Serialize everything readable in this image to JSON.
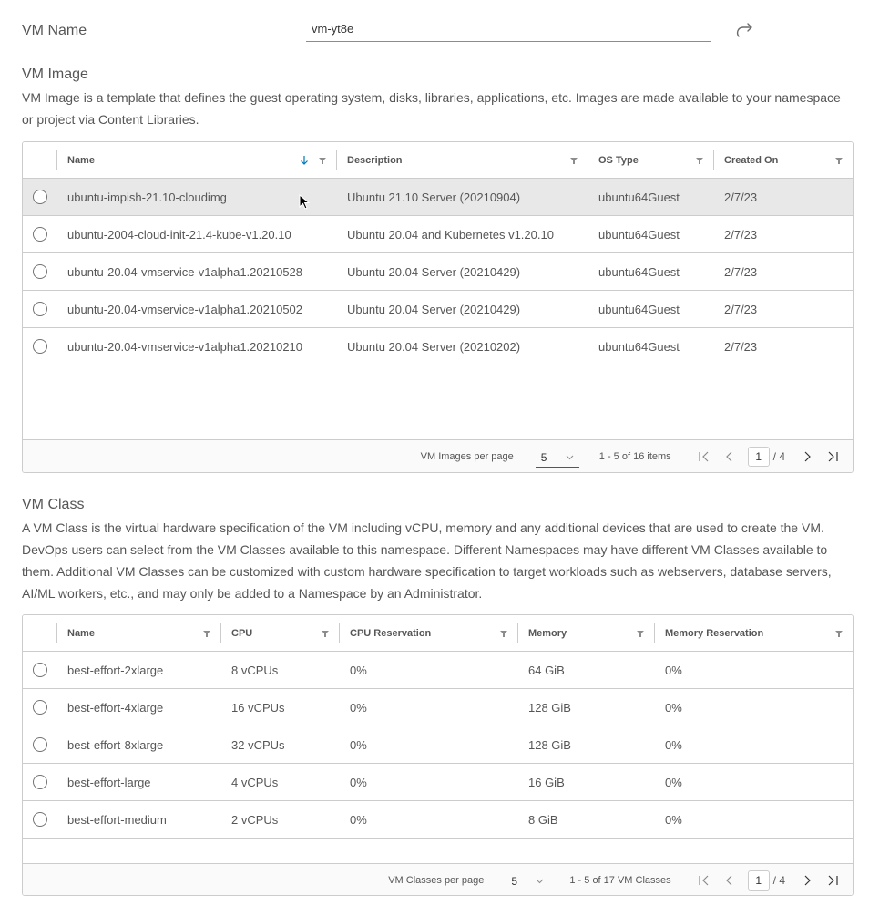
{
  "vm_name": {
    "label": "VM Name",
    "value": "vm-yt8e",
    "regenerate_icon": "redo-arrow-icon"
  },
  "vm_image": {
    "title": "VM Image",
    "description": "VM Image is a template that defines the guest operating system, disks, libraries, applications, etc. Images are made available to your namespace or project via Content Libraries.",
    "columns": [
      "Name",
      "Description",
      "OS Type",
      "Created On"
    ],
    "sorted_column": "Name",
    "sort_direction": "descending",
    "rows": [
      {
        "name": "ubuntu-impish-21.10-cloudimg",
        "description": "Ubuntu 21.10 Server (20210904)",
        "os_type": "ubuntu64Guest",
        "created_on": "2/7/23",
        "highlighted": true
      },
      {
        "name": "ubuntu-2004-cloud-init-21.4-kube-v1.20.10",
        "description": "Ubuntu 20.04 and Kubernetes v1.20.10",
        "os_type": "ubuntu64Guest",
        "created_on": "2/7/23"
      },
      {
        "name": "ubuntu-20.04-vmservice-v1alpha1.20210528",
        "description": "Ubuntu 20.04 Server (20210429)",
        "os_type": "ubuntu64Guest",
        "created_on": "2/7/23"
      },
      {
        "name": "ubuntu-20.04-vmservice-v1alpha1.20210502",
        "description": "Ubuntu 20.04 Server (20210429)",
        "os_type": "ubuntu64Guest",
        "created_on": "2/7/23"
      },
      {
        "name": "ubuntu-20.04-vmservice-v1alpha1.20210210",
        "description": "Ubuntu 20.04 Server (20210202)",
        "os_type": "ubuntu64Guest",
        "created_on": "2/7/23"
      }
    ],
    "footer": {
      "per_page_label": "VM Images per page",
      "per_page_value": "5",
      "items_count": "1 - 5 of 16 items",
      "current_page": "1",
      "total_pages": "/ 4"
    }
  },
  "vm_class": {
    "title": "VM Class",
    "description": "A VM Class is the virtual hardware specification of the VM including vCPU, memory and any additional devices that are used to create the VM. DevOps users can select from the VM Classes available to this namespace. Different Namespaces may have different VM Classes available to them. Additional VM Classes can be customized with custom hardware specification to target workloads such as webservers, database servers, AI/ML workers, etc., and may only be added to a Namespace by an Administrator.",
    "columns": [
      "Name",
      "CPU",
      "CPU Reservation",
      "Memory",
      "Memory Reservation"
    ],
    "rows": [
      {
        "name": "best-effort-2xlarge",
        "cpu": "8 vCPUs",
        "cpu_reservation": "0%",
        "memory": "64 GiB",
        "memory_reservation": "0%"
      },
      {
        "name": "best-effort-4xlarge",
        "cpu": "16 vCPUs",
        "cpu_reservation": "0%",
        "memory": "128 GiB",
        "memory_reservation": "0%"
      },
      {
        "name": "best-effort-8xlarge",
        "cpu": "32 vCPUs",
        "cpu_reservation": "0%",
        "memory": "128 GiB",
        "memory_reservation": "0%"
      },
      {
        "name": "best-effort-large",
        "cpu": "4 vCPUs",
        "cpu_reservation": "0%",
        "memory": "16 GiB",
        "memory_reservation": "0%"
      },
      {
        "name": "best-effort-medium",
        "cpu": "2 vCPUs",
        "cpu_reservation": "0%",
        "memory": "8 GiB",
        "memory_reservation": "0%"
      }
    ],
    "footer": {
      "per_page_label": "VM Classes per page",
      "per_page_value": "5",
      "items_count": "1 - 5 of 17 VM Classes",
      "current_page": "1",
      "total_pages": "/ 4"
    }
  },
  "colors": {
    "text": "#565656",
    "border": "#cccccc",
    "selected_row": "#e8e8e8",
    "sort_arrow": "#0079b8",
    "footer_bg": "#fafafa"
  }
}
